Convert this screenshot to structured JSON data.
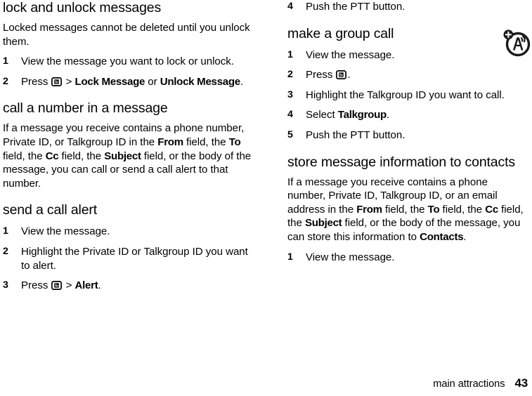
{
  "footer": {
    "section_title": "main attractions",
    "page_number": "43"
  },
  "icons": {
    "menu_key": "menu-key-icon",
    "margin_badge": "antenna-plus-badge-icon"
  },
  "left_column": {
    "sections": [
      {
        "heading": "lock and unlock messages",
        "paragraph": "Locked messages cannot be deleted until you unlock them.",
        "steps": [
          {
            "num": "1",
            "text_before": "View the message you want to lock or unlock."
          },
          {
            "num": "2",
            "text_before": "Press ",
            "icon": "menu-key-icon",
            "text_mid": " > ",
            "bold1": "Lock Message",
            "text_mid2": " or ",
            "bold2": "Unlock Message",
            "text_after": "."
          }
        ]
      },
      {
        "heading": "call a number in a message",
        "paragraph_parts": {
          "p1": "If a message you receive contains a phone number, Private ID, or Talkgroup ID in the ",
          "b1": "From",
          "p2": " field, the ",
          "b2": "To",
          "p3": " field, the ",
          "b3": "Cc",
          "p4": " field, the ",
          "b4": "Subject",
          "p5": " field, or the body of the message, you can call or send a call alert to that number."
        }
      },
      {
        "heading": "send a call alert",
        "steps": [
          {
            "num": "1",
            "text_before": "View the message."
          },
          {
            "num": "2",
            "text_before": "Highlight the Private ID or Talkgroup ID you want to alert."
          },
          {
            "num": "3",
            "text_before": "Press ",
            "icon": "menu-key-icon",
            "text_mid": " > ",
            "bold1": "Alert",
            "text_after": "."
          }
        ]
      }
    ]
  },
  "right_column": {
    "continued_step": {
      "num": "4",
      "text": "Push the PTT button."
    },
    "sections": [
      {
        "heading": "make a group call",
        "has_margin_icon": true,
        "steps": [
          {
            "num": "1",
            "text_before": "View the message."
          },
          {
            "num": "2",
            "text_before": "Press ",
            "icon": "menu-key-icon",
            "text_after": "."
          },
          {
            "num": "3",
            "text_before": "Highlight the Talkgroup ID you want to call."
          },
          {
            "num": "4",
            "text_before": "Select ",
            "bold1": "Talkgroup",
            "text_after": "."
          },
          {
            "num": "5",
            "text_before": "Push the PTT button."
          }
        ]
      },
      {
        "heading": "store message information to contacts",
        "paragraph_parts": {
          "p1": "If a message you receive contains a phone number, Private ID, Talkgroup ID, or an email address in the ",
          "b1": "From",
          "p2": " field, the ",
          "b2": "To",
          "p3": " field, the ",
          "b3": "Cc",
          "p4": " field, the ",
          "b4": "Subject",
          "p5": " field, or the body of the message, you can store this information to ",
          "b5": "Contacts",
          "p6": "."
        },
        "steps": [
          {
            "num": "1",
            "text_before": "View the message."
          }
        ]
      }
    ]
  }
}
